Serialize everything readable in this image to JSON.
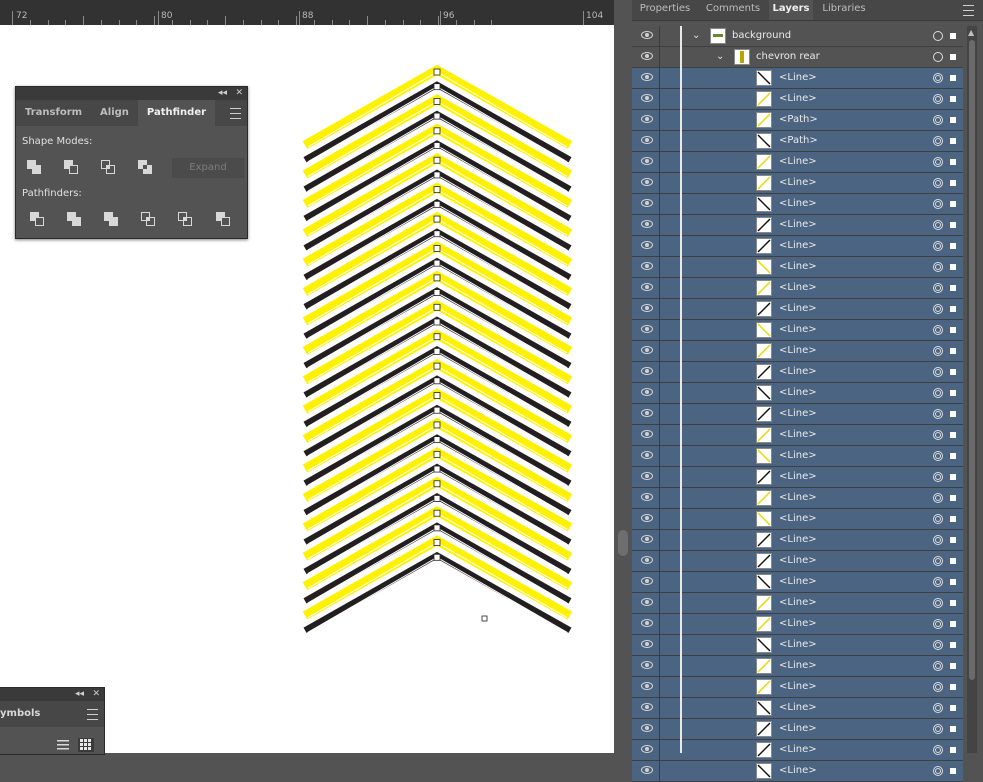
{
  "ruler": {
    "labels": [
      "72",
      "80",
      "88",
      "96",
      "104"
    ]
  },
  "pathfinder_panel": {
    "collapse_glyph": "◂◂",
    "close_glyph": "✕",
    "tabs": [
      "Transform",
      "Align",
      "Pathfinder"
    ],
    "active_tab": "Pathfinder",
    "shape_modes_label": "Shape Modes:",
    "pathfinders_label": "Pathfinders:",
    "expand_label": "Expand",
    "shape_mode_icons": [
      "unite-icon",
      "minus-front-icon",
      "intersect-icon",
      "exclude-icon"
    ],
    "pathfinder_icons": [
      "divide-icon",
      "trim-icon",
      "merge-icon",
      "crop-icon",
      "outline-icon",
      "minus-back-icon"
    ]
  },
  "symbols_panel": {
    "tab_label": "ymbols",
    "collapse_glyph": "◂◂",
    "close_glyph": "✕"
  },
  "layers_panel": {
    "tabs": [
      "Properties",
      "Comments",
      "Layers",
      "Libraries"
    ],
    "active_tab": "Layers",
    "layer_name": "background",
    "sublayer_name": "chevron rear",
    "items": [
      {
        "label": "<Line>",
        "thumb": "black"
      },
      {
        "label": "<Line>",
        "thumb": "yellow"
      },
      {
        "label": "<Path>",
        "thumb": "yellow"
      },
      {
        "label": "<Path>",
        "thumb": "black"
      },
      {
        "label": "<Line>",
        "thumb": "yellow"
      },
      {
        "label": "<Line>",
        "thumb": "yellow"
      },
      {
        "label": "<Line>",
        "thumb": "black"
      },
      {
        "label": "<Line>",
        "thumb": "black"
      },
      {
        "label": "<Line>",
        "thumb": "black"
      },
      {
        "label": "<Line>",
        "thumb": "yellow"
      },
      {
        "label": "<Line>",
        "thumb": "yellow"
      },
      {
        "label": "<Line>",
        "thumb": "black"
      },
      {
        "label": "<Line>",
        "thumb": "yellow"
      },
      {
        "label": "<Line>",
        "thumb": "yellow"
      },
      {
        "label": "<Line>",
        "thumb": "black"
      },
      {
        "label": "<Line>",
        "thumb": "black"
      },
      {
        "label": "<Line>",
        "thumb": "black"
      },
      {
        "label": "<Line>",
        "thumb": "yellow"
      },
      {
        "label": "<Line>",
        "thumb": "yellow"
      },
      {
        "label": "<Line>",
        "thumb": "black"
      },
      {
        "label": "<Line>",
        "thumb": "yellow"
      },
      {
        "label": "<Line>",
        "thumb": "yellow"
      },
      {
        "label": "<Line>",
        "thumb": "black"
      },
      {
        "label": "<Line>",
        "thumb": "black"
      },
      {
        "label": "<Line>",
        "thumb": "black"
      },
      {
        "label": "<Line>",
        "thumb": "yellow"
      },
      {
        "label": "<Line>",
        "thumb": "yellow"
      },
      {
        "label": "<Line>",
        "thumb": "black"
      },
      {
        "label": "<Line>",
        "thumb": "yellow"
      },
      {
        "label": "<Line>",
        "thumb": "yellow"
      },
      {
        "label": "<Line>",
        "thumb": "black"
      },
      {
        "label": "<Line>",
        "thumb": "black"
      },
      {
        "label": "<Line>",
        "thumb": "black"
      },
      {
        "label": "<Line>",
        "thumb": "black"
      }
    ]
  },
  "artwork": {
    "stripe_colors": [
      "#fff200",
      "#231f20"
    ],
    "stripe_count": 34
  },
  "colors": {
    "selection_row": "#4a6482",
    "panel_bg": "#535353",
    "accent_yellow": "#fff200",
    "accent_black": "#231f20"
  }
}
